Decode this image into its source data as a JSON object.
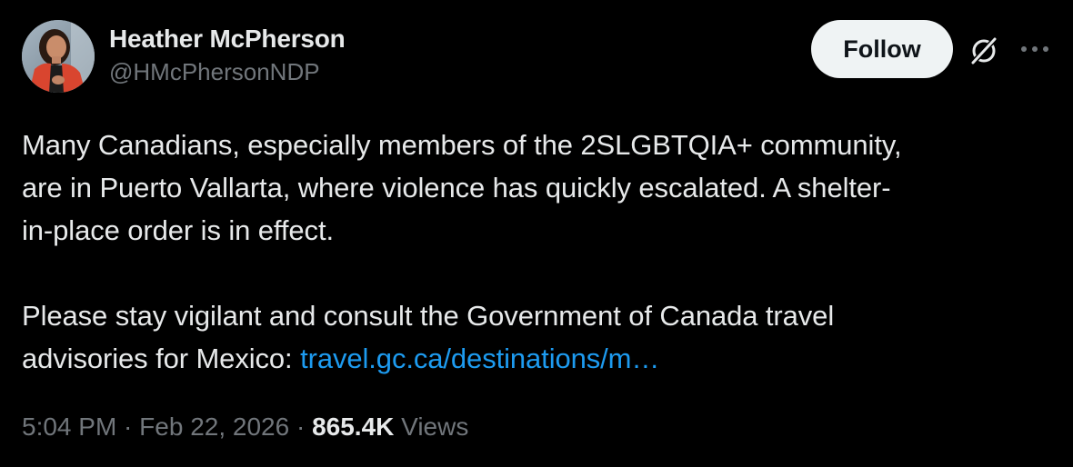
{
  "author": {
    "display_name": "Heather McPherson",
    "handle": "@HMcPhersonNDP"
  },
  "actions": {
    "follow_label": "Follow",
    "grok_icon": "grok-icon",
    "more_icon": "more-horizontal-icon"
  },
  "tweet": {
    "text_line_1": "Many Canadians, especially members of the 2SLGBTQIA+ community,",
    "text_line_2": "are in Puerto Vallarta, where violence has quickly escalated. A shelter-",
    "text_line_3": "in-place order is in effect.",
    "text_line_4": "Please stay vigilant and consult the Government of Canada travel",
    "text_line_5_prefix": "advisories for Mexico: ",
    "link_text": "travel.gc.ca/destinations/m…"
  },
  "meta": {
    "time": "5:04 PM",
    "separator_1": " · ",
    "date": "Feb 22, 2026",
    "separator_2": " · ",
    "views_count": "865.4K",
    "views_label": " Views"
  },
  "colors": {
    "background": "#000000",
    "text_primary": "#e7e9ea",
    "text_secondary": "#71767b",
    "link": "#1d9bf0",
    "follow_bg": "#eff3f4",
    "follow_text": "#0f1419"
  }
}
